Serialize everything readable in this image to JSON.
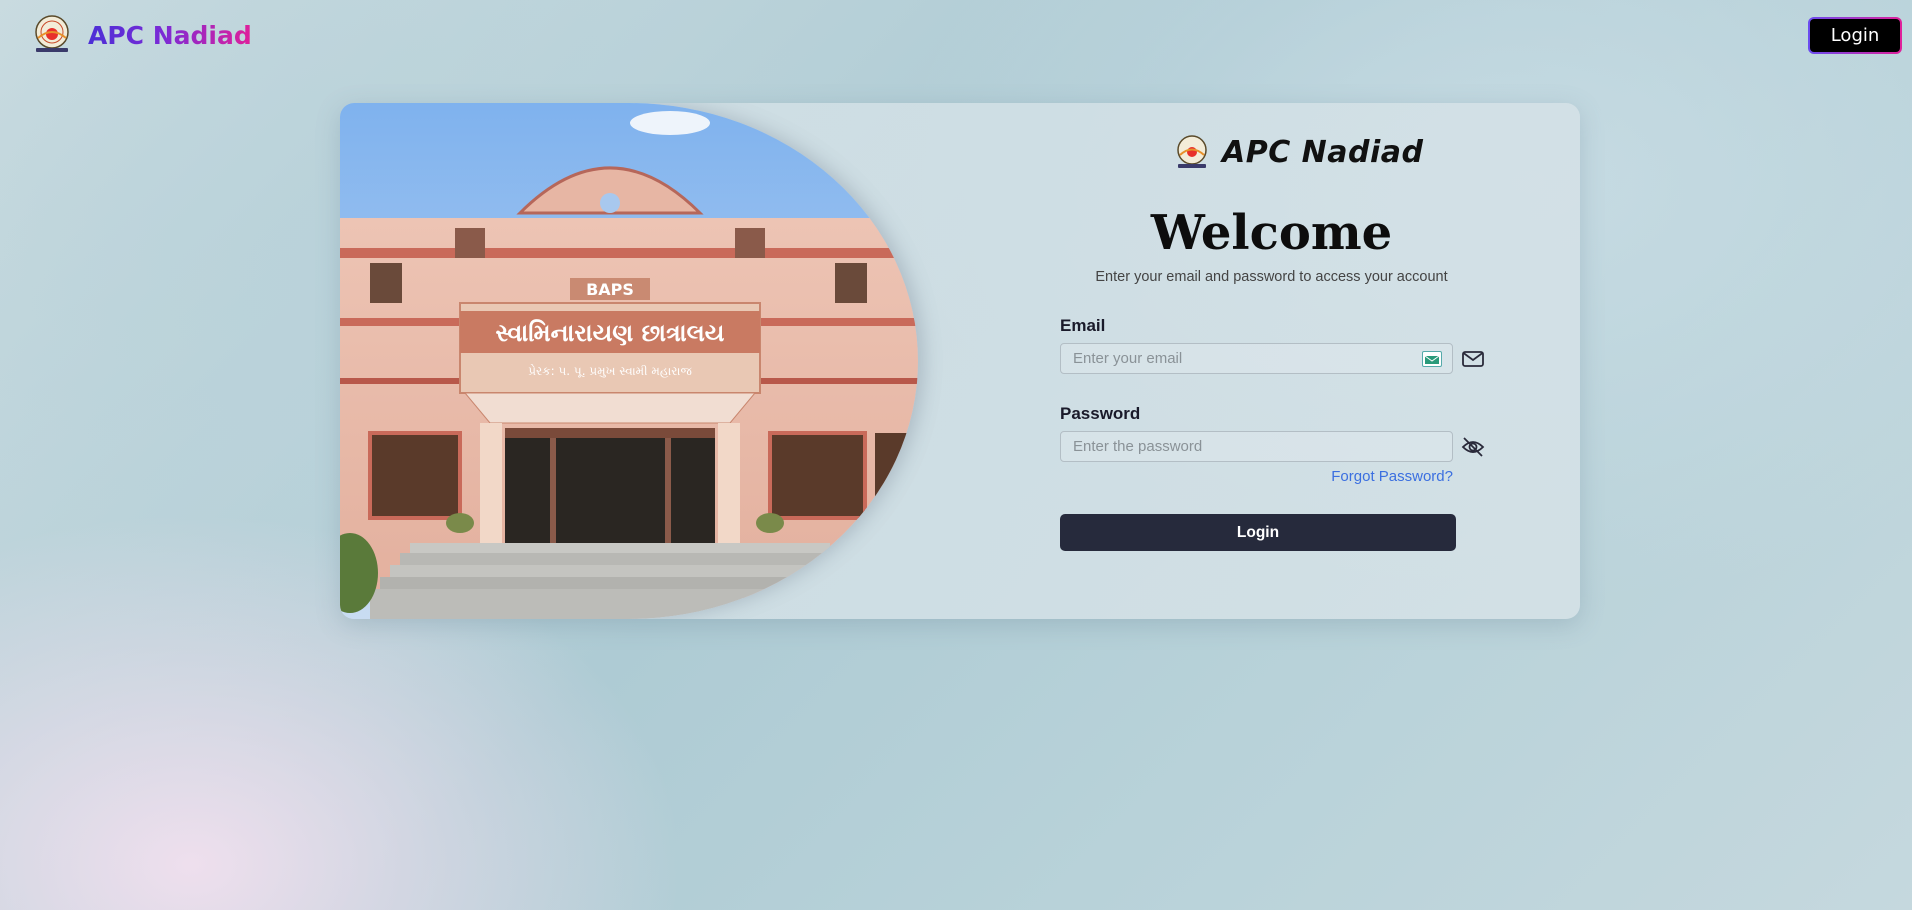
{
  "header": {
    "brand_name": "APC Nadiad",
    "login_label": "Login"
  },
  "card": {
    "image": {
      "sign_top": "BAPS",
      "sign_main": "સ્વામિનારાયણ છાત્રાલય",
      "sign_sub": "પ્રેરક: પ. પૂ. પ્રમુખ સ્વામી મહારાજ"
    },
    "form": {
      "brand_name": "APC Nadiad",
      "title": "Welcome",
      "subtitle": "Enter your email and password to access your account",
      "email_label": "Email",
      "email_placeholder": "Enter your email",
      "email_value": "",
      "password_label": "Password",
      "password_placeholder": "Enter the password",
      "password_value": "",
      "forgot_label": "Forgot Password?",
      "submit_label": "Login"
    }
  },
  "colors": {
    "brand_gradient_start": "#4b2fd6",
    "brand_gradient_end": "#e0209a",
    "submit_bg": "#262a3c",
    "link": "#3b6fe0"
  },
  "icons": {
    "email": "mail-icon",
    "password": "eye-off-icon",
    "logo": "baps-emblem-icon"
  }
}
